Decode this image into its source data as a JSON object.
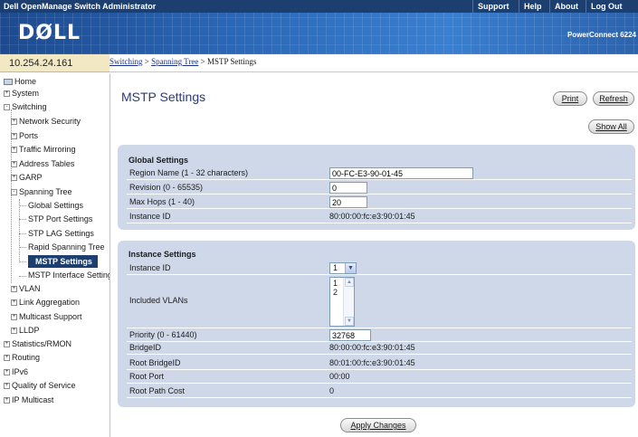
{
  "topbar": {
    "title": "Dell OpenManage Switch Administrator",
    "links": [
      "Support",
      "Help",
      "About",
      "Log Out"
    ]
  },
  "banner": {
    "logo": "DØLL",
    "product": "PowerConnect 6224"
  },
  "address": "10.254.24.161",
  "breadcrumb": {
    "items": [
      "Switching",
      "Spanning Tree",
      "MSTP Settings"
    ],
    "separator": " > "
  },
  "nav": {
    "items": [
      {
        "label": "Home",
        "icon": "home-icon"
      },
      {
        "label": "System",
        "toggle": "+"
      },
      {
        "label": "Switching",
        "toggle": "-"
      },
      {
        "label": "Network Security",
        "toggle": "+"
      },
      {
        "label": "Ports",
        "toggle": "+"
      },
      {
        "label": "Traffic Mirroring",
        "toggle": "+"
      },
      {
        "label": "Address Tables",
        "toggle": "+"
      },
      {
        "label": "GARP",
        "toggle": "+"
      },
      {
        "label": "Spanning Tree",
        "toggle": "-"
      },
      {
        "label": "Global Settings"
      },
      {
        "label": "STP Port Settings"
      },
      {
        "label": "STP LAG Settings"
      },
      {
        "label": "Rapid Spanning Tree"
      },
      {
        "label": "MSTP Settings",
        "active": true
      },
      {
        "label": "MSTP Interface Settings"
      },
      {
        "label": "VLAN",
        "toggle": "+"
      },
      {
        "label": "Link Aggregation",
        "toggle": "+"
      },
      {
        "label": "Multicast Support",
        "toggle": "+"
      },
      {
        "label": "LLDP",
        "toggle": "+"
      },
      {
        "label": "Statistics/RMON",
        "toggle": "+"
      },
      {
        "label": "Routing",
        "toggle": "+"
      },
      {
        "label": "IPv6",
        "toggle": "+"
      },
      {
        "label": "Quality of Service",
        "toggle": "+"
      },
      {
        "label": "IP Multicast",
        "toggle": "+"
      }
    ]
  },
  "page": {
    "title": "MSTP Settings",
    "print_label": "Print",
    "refresh_label": "Refresh",
    "show_all_label": "Show All",
    "apply_label": "Apply Changes"
  },
  "global": {
    "heading": "Global Settings",
    "region_name_label": "Region Name (1 - 32 characters)",
    "region_name_value": "00-FC-E3-90-01-45",
    "revision_label": "Revision (0 - 65535)",
    "revision_value": "0",
    "max_hops_label": "Max Hops (1 - 40)",
    "max_hops_value": "20",
    "instance_id_label": "Instance ID",
    "instance_id_value": "80:00:00:fc:e3:90:01:45"
  },
  "instance": {
    "heading": "Instance Settings",
    "instance_id_label": "Instance ID",
    "instance_id_selected": "1",
    "included_vlans_label": "Included VLANs",
    "included_vlans_options": [
      "1",
      "2"
    ],
    "priority_label": "Priority (0 - 61440)",
    "priority_value": "32768",
    "bridge_id_label": "BridgeID",
    "bridge_id_value": "80:00:00:fc:e3:90:01:45",
    "root_bridge_id_label": "Root BridgeID",
    "root_bridge_id_value": "80:01:00:fc:e3:90:01:45",
    "root_port_label": "Root Port",
    "root_port_value": "00:00",
    "root_path_cost_label": "Root Path Cost",
    "root_path_cost_value": "0"
  },
  "colors": {
    "topbar": "#1d3f70",
    "section_bg": "#cfd8e8",
    "title": "#2a3b7a",
    "address_bg": "#f3e8c4"
  }
}
